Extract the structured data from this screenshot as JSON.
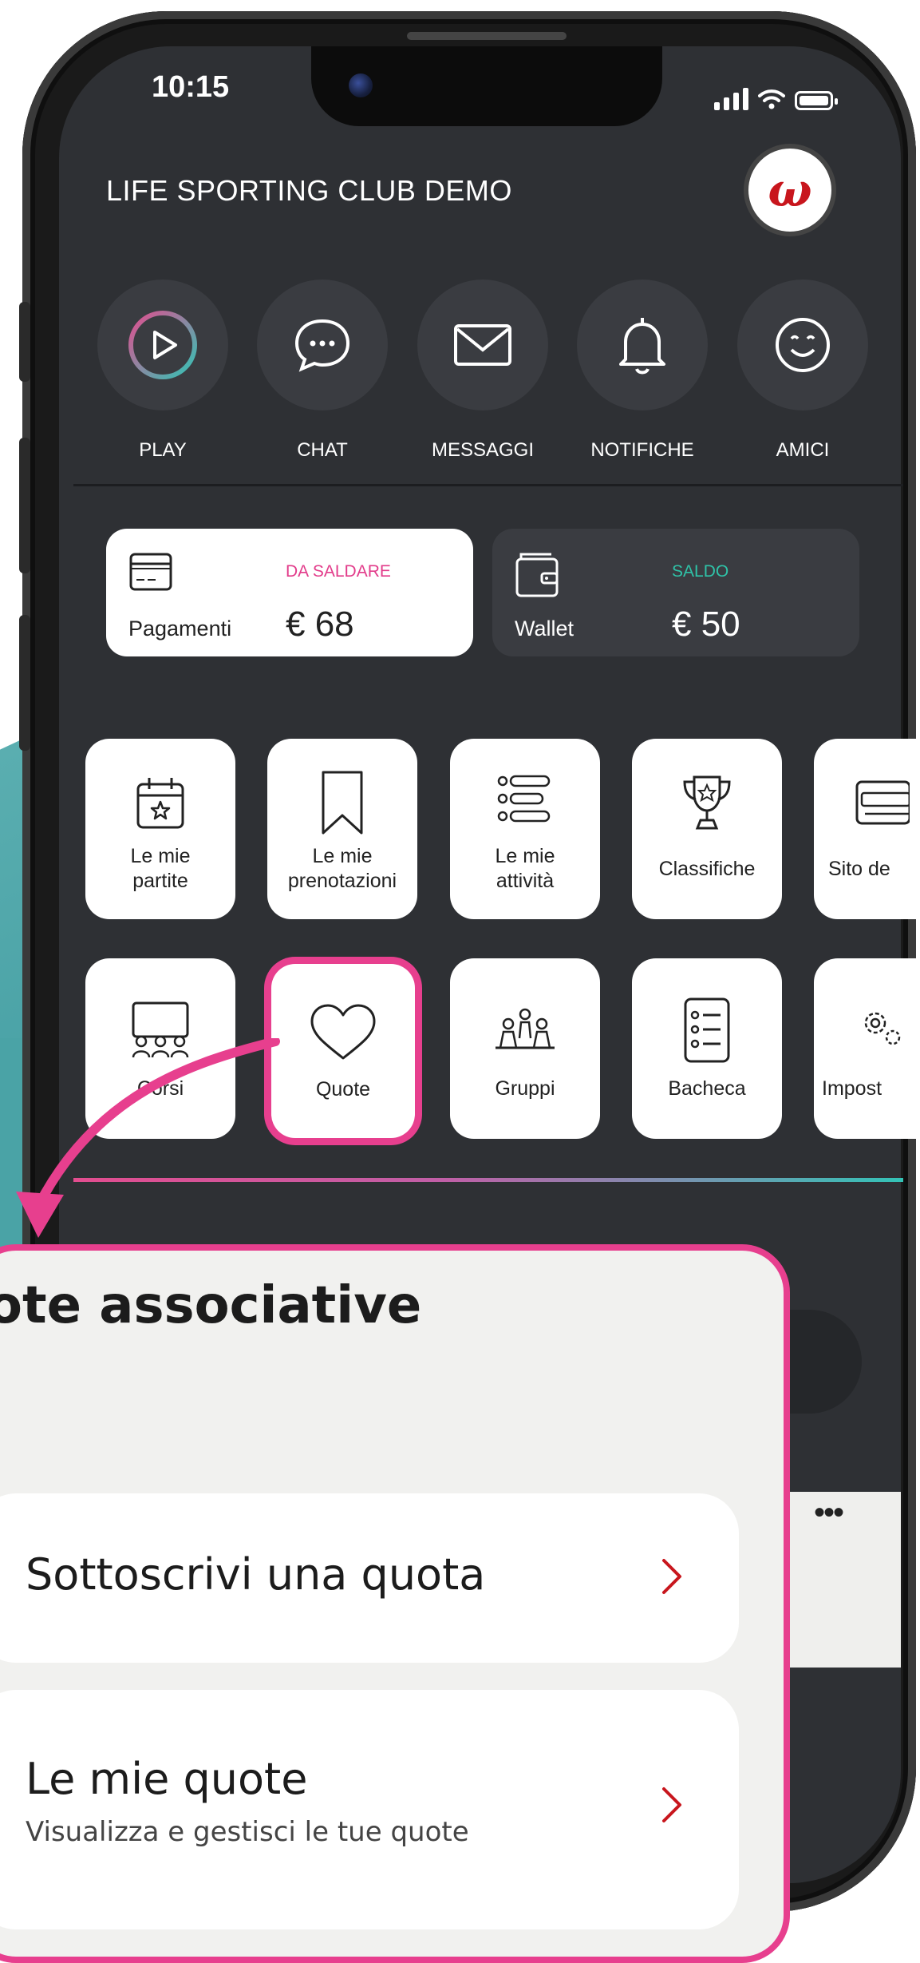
{
  "status_bar": {
    "time": "10:15"
  },
  "header": {
    "club_name": "LIFE SPORTING CLUB DEMO",
    "logo_text": "ω"
  },
  "quick_actions": [
    {
      "label": "PLAY",
      "icon": "play-icon"
    },
    {
      "label": "CHAT",
      "icon": "chat-bubble-icon"
    },
    {
      "label": "MESSAGGI",
      "icon": "envelope-icon"
    },
    {
      "label": "NOTIFICHE",
      "icon": "bell-icon"
    },
    {
      "label": "AMICI",
      "icon": "smiley-icon"
    }
  ],
  "payments": {
    "label": "Pagamenti",
    "tag": "DA SALDARE",
    "amount": "€ 68",
    "tag_color": "#e23b8a"
  },
  "wallet": {
    "label": "Wallet",
    "tag": "SALDO",
    "amount": "€ 50",
    "tag_color": "#2fc3a8"
  },
  "tiles_row1": [
    {
      "label_line1": "Le mie",
      "label_line2": "partite",
      "icon": "calendar-star-icon"
    },
    {
      "label_line1": "Le mie",
      "label_line2": "prenotazioni",
      "icon": "bookmark-icon"
    },
    {
      "label_line1": "Le mie",
      "label_line2": "attività",
      "icon": "list-icon"
    },
    {
      "label_line1": "Classifiche",
      "label_line2": "",
      "icon": "trophy-icon"
    },
    {
      "label_line1": "Sito de",
      "label_line2": "",
      "icon": "website-icon"
    }
  ],
  "tiles_row2": [
    {
      "label": "Corsi",
      "icon": "classroom-icon"
    },
    {
      "label": "Quote",
      "icon": "heart-icon"
    },
    {
      "label": "Gruppi",
      "icon": "group-icon"
    },
    {
      "label": "Bacheca",
      "icon": "board-icon"
    },
    {
      "label": "Impost",
      "icon": "settings-icon"
    }
  ],
  "overlay": {
    "title": "ote associative",
    "items": [
      {
        "title": "Sottoscrivi una quota",
        "subtitle": ""
      },
      {
        "title": "Le mie quote",
        "subtitle": "Visualizza e gestisci le tue quote"
      }
    ]
  },
  "colors": {
    "accent": "#e73f8e",
    "screen_bg": "#2e3034",
    "tile_bg": "#ffffff"
  }
}
